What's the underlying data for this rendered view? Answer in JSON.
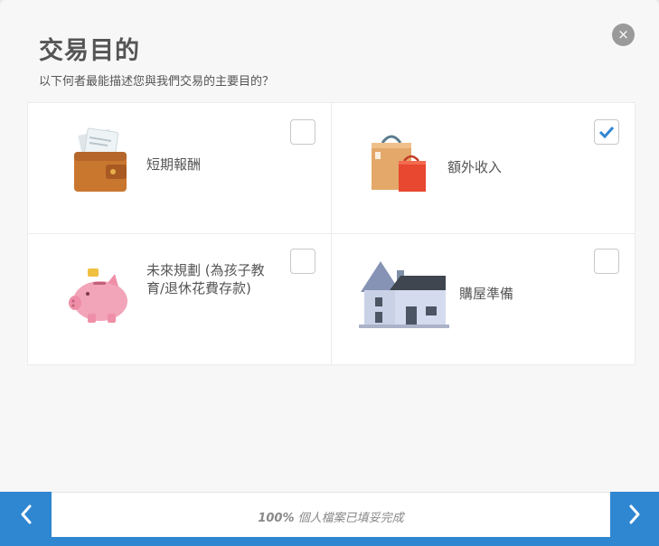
{
  "dialog": {
    "title": "交易目的",
    "subtitle": "以下何者最能描述您與我們交易的主要目的？",
    "close_label": "×"
  },
  "options": [
    {
      "label": "短期報酬",
      "checked": false,
      "icon": "wallet-icon"
    },
    {
      "label": "額外收入",
      "checked": true,
      "icon": "shopping-bags-icon"
    },
    {
      "label": "未來規劃 (為孩子教育/退休花費存款)",
      "label_lines": [
        "未來規劃 (為孩子教",
        "育/退休花費存款)"
      ],
      "checked": false,
      "icon": "piggy-bank-icon"
    },
    {
      "label": "購屋準備",
      "checked": false,
      "icon": "house-icon"
    }
  ],
  "footer": {
    "progress_percent_label": "100%",
    "progress_text": "個人檔案已填妥完成",
    "progress_fraction": 1.0,
    "prev_icon": "chevron-left-icon",
    "next_icon": "chevron-right-icon"
  },
  "colors": {
    "accent": "#2f86d1",
    "check": "#2f86d1"
  }
}
